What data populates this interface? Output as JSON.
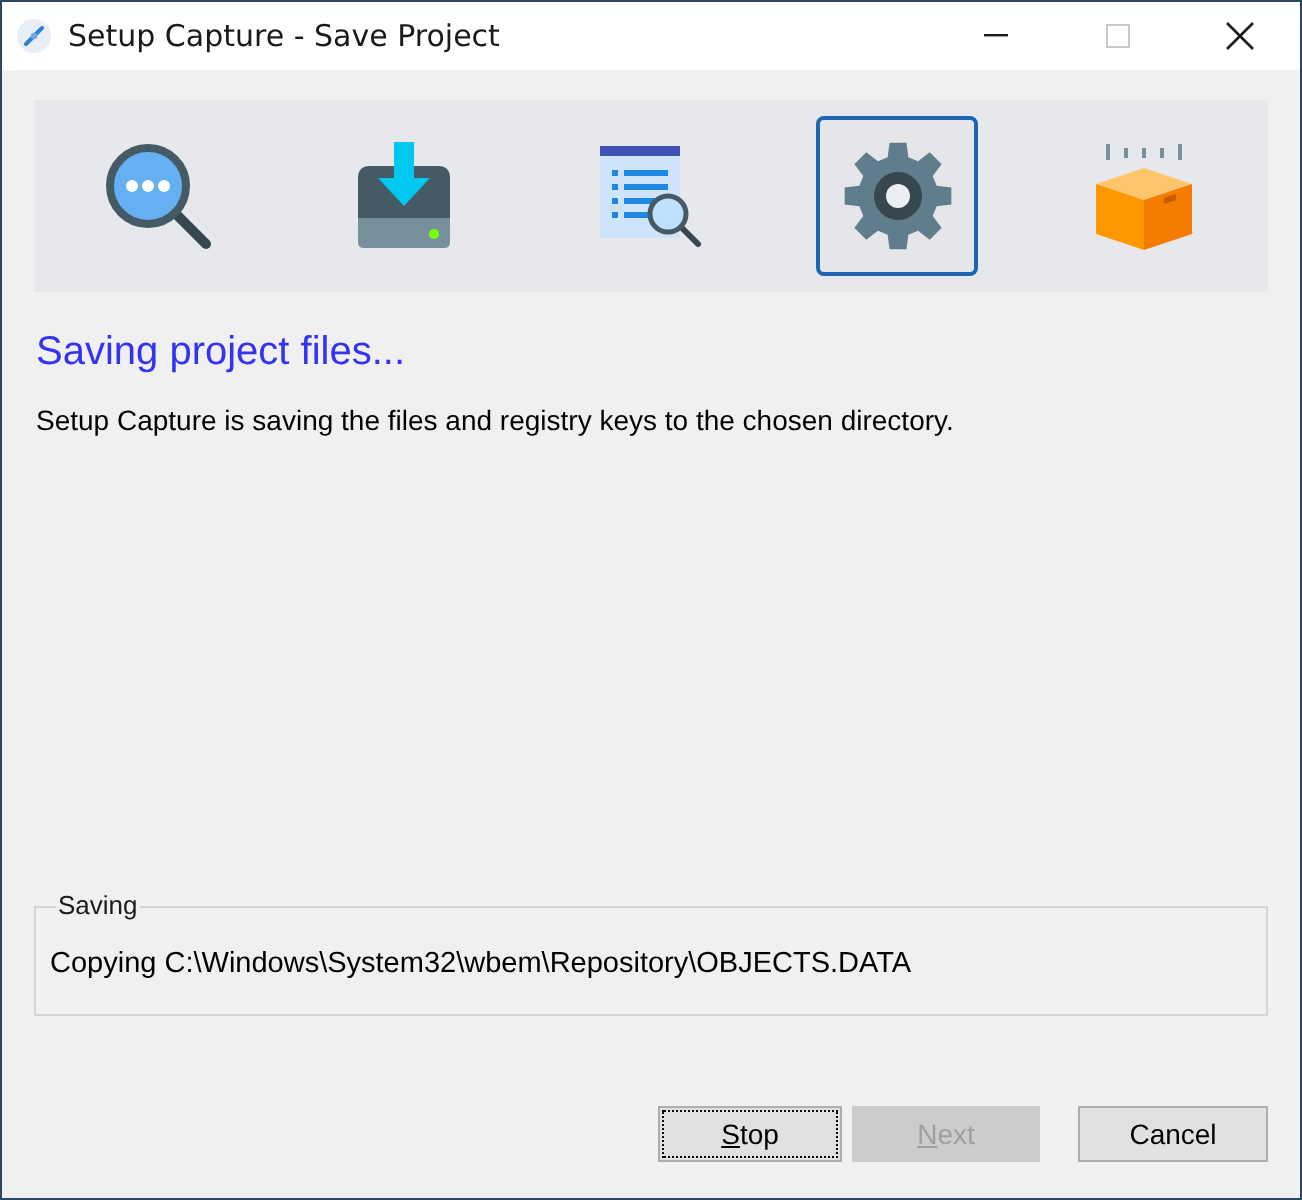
{
  "window": {
    "title": "Setup Capture - Save Project",
    "controls": [
      {
        "kind": "minimize",
        "disabled": false
      },
      {
        "kind": "maximize",
        "disabled": true
      },
      {
        "kind": "close",
        "disabled": false
      }
    ]
  },
  "steps": [
    {
      "selected": false
    },
    {
      "selected": false
    },
    {
      "selected": false
    },
    {
      "selected": true
    },
    {
      "selected": false
    }
  ],
  "heading": "Saving project files...",
  "description": "Setup Capture is saving the files and registry keys to the chosen directory.",
  "group": {
    "title": "Saving",
    "status": "Copying C:\\Windows\\System32\\wbem\\Repository\\OBJECTS.DATA"
  },
  "buttons": [
    {
      "access_key": "S",
      "label": "top",
      "focused": true,
      "disabled": false
    },
    {
      "access_key": "N",
      "label": "ext",
      "focused": false,
      "disabled": true
    },
    {
      "label": "Cancel",
      "focused": false,
      "disabled": false
    }
  ]
}
